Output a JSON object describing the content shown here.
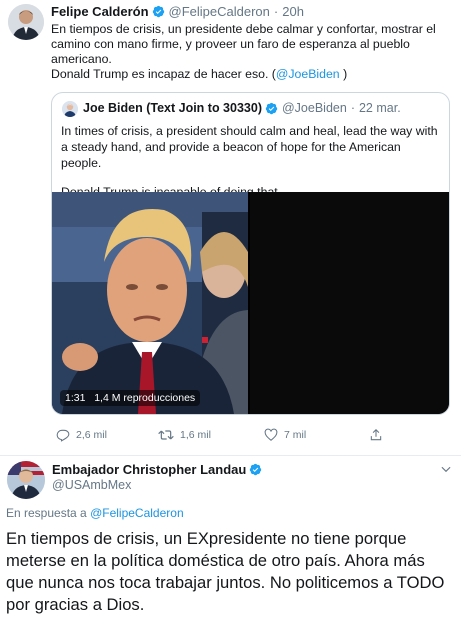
{
  "tweet1": {
    "author_name": "Felipe Calderón",
    "handle": "@FelipeCalderon",
    "separator": "·",
    "time": "20h",
    "text_lines": [
      "En tiempos de crisis, un presidente debe calmar y confortar, mostrar el",
      "camino con mano firme, y proveer un faro de esperanza al pueblo",
      "americano."
    ],
    "text_last_prefix": "Donald Trump es incapaz de hacer eso. (",
    "text_last_link": "@JoeBiden",
    "text_last_suffix": " )",
    "quoted": {
      "author_name": "Joe Biden (Text Join to 30330)",
      "handle": "@JoeBiden",
      "separator": "·",
      "date": "22 mar.",
      "paragraph1": "In times of crisis, a president should calm and heal, lead the way with a steady hand, and provide a beacon of hope for the American people.",
      "paragraph2": "Donald Trump is incapable of doing that.",
      "media": {
        "duration": "1:31",
        "views": "1,4 M reproducciones"
      }
    },
    "actions": {
      "replies": "2,6 mil",
      "retweets": "1,6 mil",
      "likes": "7 mil"
    }
  },
  "tweet2": {
    "author_name": "Embajador Christopher Landau",
    "handle": "@USAmbMex",
    "reply_label": "En respuesta a ",
    "reply_link": "@FelipeCalderon",
    "text": "En tiempos de crisis, un EXpresidente no tiene porque meterse en la política doméstica de otro país. Ahora más que nunca nos toca trabajar juntos. No politicemos a TODO por gracias a Dios."
  },
  "colors": {
    "accent": "#1b95e0",
    "muted": "#657786",
    "border": "#e6ecf0"
  }
}
